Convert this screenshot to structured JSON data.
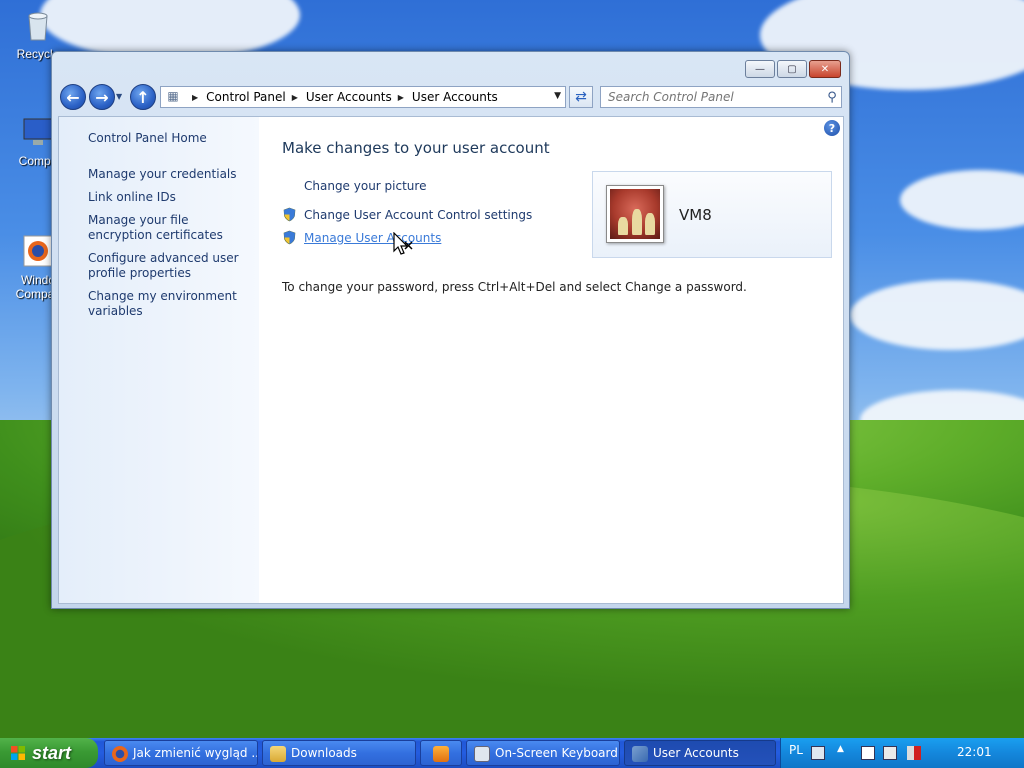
{
  "desktop": {
    "icons": [
      {
        "label": "Recycle"
      },
      {
        "label": "Compu"
      },
      {
        "label": "Windo\nCompati"
      }
    ]
  },
  "window": {
    "controls": {
      "minimize": "—",
      "maximize": "▢",
      "close": "✕"
    },
    "address": {
      "root_icon": "control-panel-icon",
      "crumbs": [
        "Control Panel",
        "User Accounts",
        "User Accounts"
      ]
    },
    "search": {
      "placeholder": "Search Control Panel"
    },
    "sidebar": {
      "items": [
        {
          "label": "Control Panel Home"
        },
        {
          "label": "Manage your credentials"
        },
        {
          "label": "Link online IDs"
        },
        {
          "label": "Manage your file encryption certificates"
        },
        {
          "label": "Configure advanced user profile properties"
        },
        {
          "label": "Change my environment variables"
        }
      ]
    },
    "main": {
      "title": "Make changes to your user account",
      "tasks": [
        {
          "label": "Change your picture",
          "shield": false
        },
        {
          "label": "Change User Account Control settings",
          "shield": true
        },
        {
          "label": "Manage User Accounts",
          "shield": true
        }
      ],
      "password_note": "To change your password, press Ctrl+Alt+Del and select Change a password.",
      "user": {
        "name": "VM8"
      }
    }
  },
  "taskbar": {
    "start_label": "start",
    "buttons": [
      {
        "label": "Jak zmienić wygląd ...",
        "icon": "firefox-icon"
      },
      {
        "label": "Downloads",
        "icon": "folder-icon"
      },
      {
        "label": "",
        "icon": "media-player-icon"
      },
      {
        "label": "On-Screen Keyboard",
        "icon": "keyboard-icon"
      },
      {
        "label": "User Accounts",
        "icon": "control-panel-icon"
      }
    ],
    "tray": {
      "language": "PL",
      "clock": "22:01"
    }
  },
  "colors": {
    "link": "#1e3a6e",
    "link_hover": "#3a7ad8",
    "taskbar": "#245de0",
    "start": "#3a9a34",
    "tray": "#1487dc"
  }
}
